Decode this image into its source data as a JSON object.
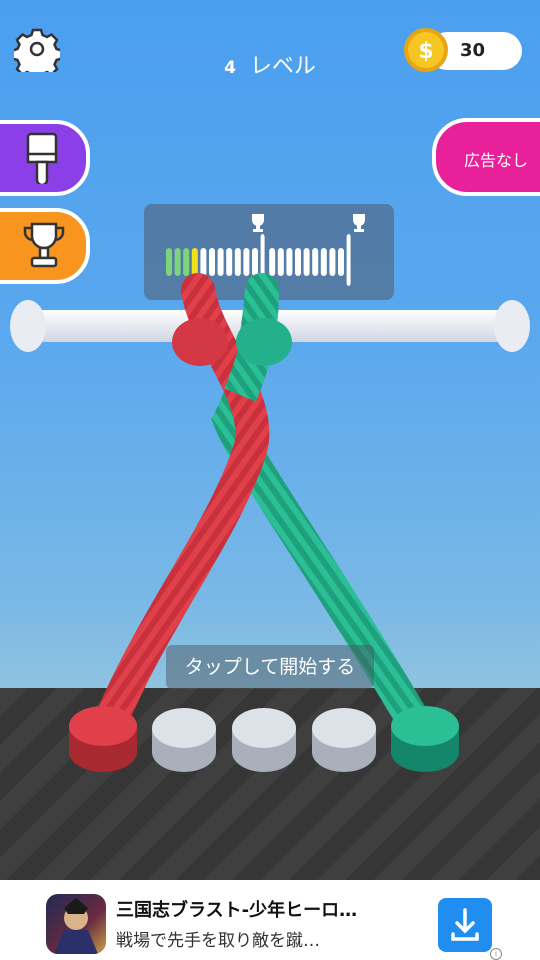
{
  "hud": {
    "level_number": "4",
    "level_label": "レベル",
    "coins": "30",
    "no_ads_label": "広告なし"
  },
  "progress": {
    "segments_completed": 3,
    "current_segment": 4,
    "milestone_icons": [
      "trophy-icon",
      "trophy-icon"
    ]
  },
  "prompt": {
    "tap_to_start": "タップして開始する"
  },
  "ad": {
    "title": "三国志ブラスト-少年ヒーロ…",
    "subtitle": "戦場で先手を取り敵を蹴…"
  },
  "colors": {
    "sky": "#4b9fef",
    "red_rope": "#e0404a",
    "green_rope": "#2bbf95",
    "skin_button": "#8b3fe6",
    "trophy_button": "#f7951f",
    "no_ads_button": "#e8209a",
    "coin": "#f4c020",
    "progress_green": "#7ed47a",
    "progress_yellow": "#f2e11a"
  },
  "pegs": [
    "red",
    "empty",
    "empty",
    "empty",
    "green"
  ]
}
